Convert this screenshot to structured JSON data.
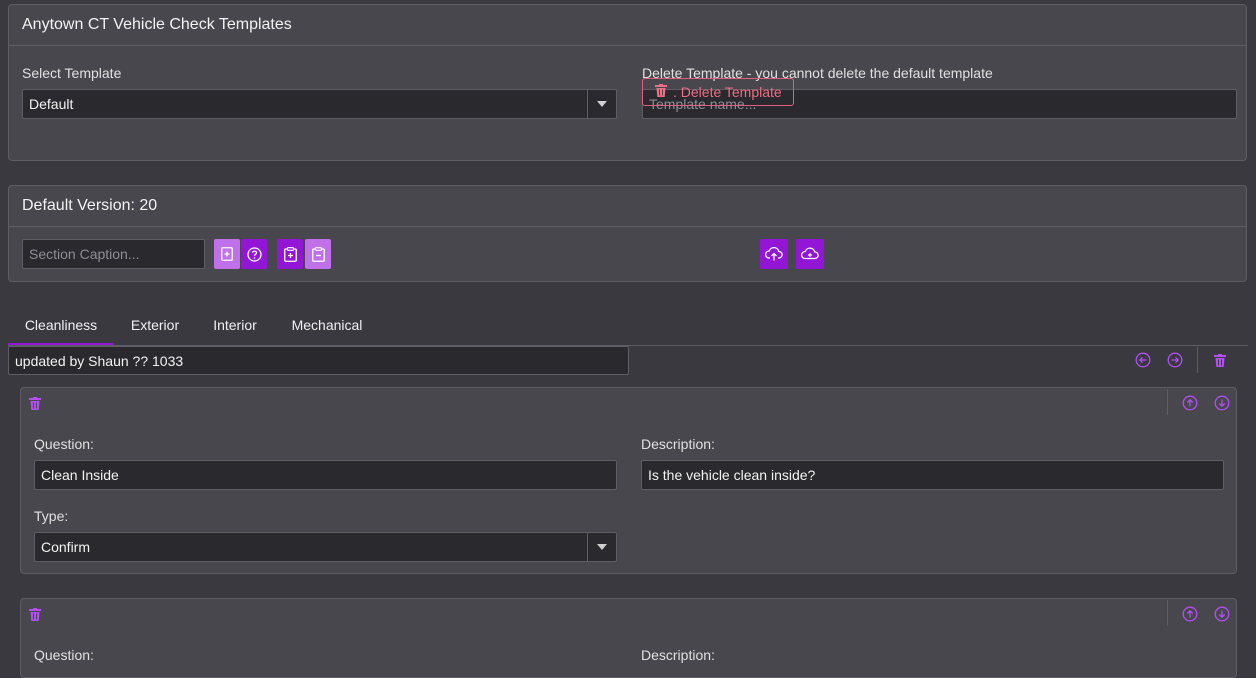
{
  "templates": {
    "title": "Anytown CT Vehicle Check Templates",
    "select_label": "Select Template",
    "selected": "Default",
    "delete_label": "Delete Template - you cannot delete the default template",
    "delete_placeholder": "Template name...",
    "delete_button": ". Delete Template"
  },
  "version": {
    "title": "Default Version: 20",
    "caption_placeholder": "Section Caption..."
  },
  "tabs": [
    "Cleanliness",
    "Exterior",
    "Interior",
    "Mechanical"
  ],
  "section": {
    "caption": "updated by Shaun ?? 1033"
  },
  "question1": {
    "question_label": "Question:",
    "question_value": "Clean Inside",
    "description_label": "Description:",
    "description_value": "Is the vehicle clean inside?",
    "type_label": "Type:",
    "type_value": "Confirm"
  },
  "question2": {
    "question_label": "Question:",
    "description_label": "Description:"
  },
  "colors": {
    "accent": "#9316d6",
    "accent_light": "#c070e8",
    "danger": "#ef6d86",
    "background": "#3a3940",
    "card": "#48474d"
  }
}
